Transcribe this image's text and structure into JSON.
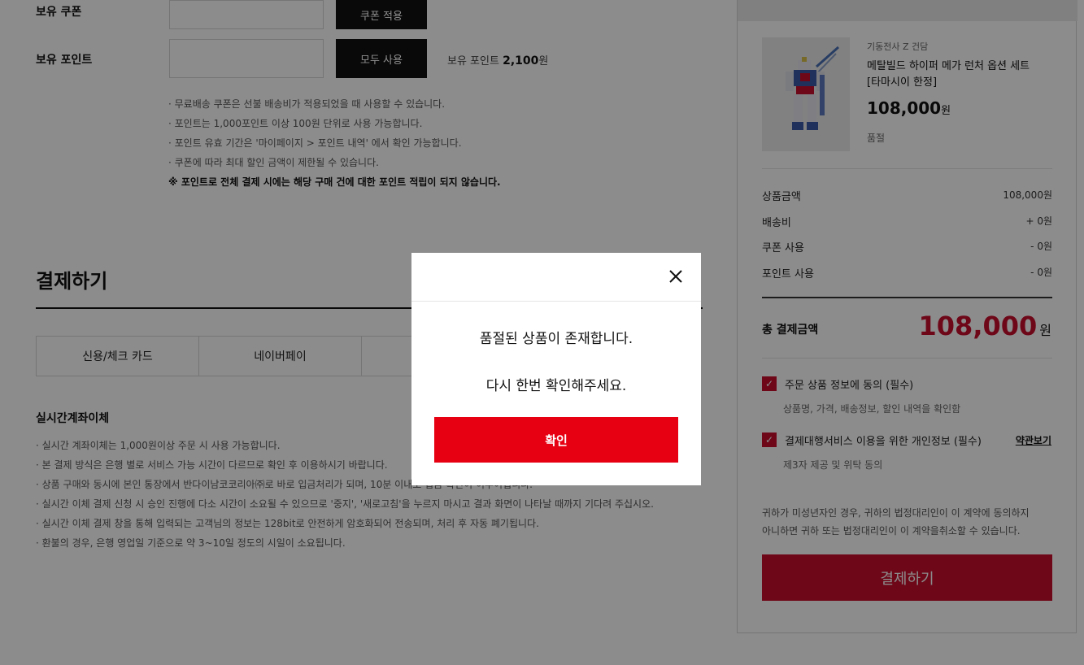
{
  "discount": {
    "coupon_label": "보유 쿠폰",
    "coupon_button": "쿠폰 적용",
    "point_label": "보유 포인트",
    "point_button": "모두 사용",
    "point_balance_prefix": "보유 포인트",
    "point_balance_value": "2,100",
    "point_balance_unit": "원",
    "notes": [
      "· 무료배송 쿠폰은 선불 배송비가 적용되었을 때 사용할 수 있습니다.",
      "· 포인트는 1,000포인트 이상 100원 단위로 사용 가능합니다.",
      "· 포인트 유효 기간은 '마이페이지 > 포인트 내역' 에서 확인 가능합니다.",
      "· 쿠폰에 따라 최대 할인 금액이 제한될 수 있습니다."
    ],
    "notice_strong": "※ 포인트로 전체 결제 시에는 해당 구매 건에 대한 포인트 적립이 되지 않습니다."
  },
  "payment": {
    "title": "결제하기",
    "tabs": [
      "신용/체크 카드",
      "네이버페이",
      ""
    ],
    "selected_method_title": "실시간계좌이체",
    "notes": [
      "· 실시간 계좌이체는 1,000원이상 주문 시 사용 가능합니다.",
      "· 본 결제 방식은 은행 별로 서비스 가능 시간이 다르므로 확인 후 이용하시기 바랍니다.",
      "· 상품 구매와 동시에 본인 통장에서 반다이남코코리아㈜로 바로 입금처리가 되며, 10분 이내로 입금 확인이 이루어집니다.",
      "· 실시간 이체 결제 신청 시 승인 진행에 다소 시간이 소요될 수 있으므로 '중지', '새로고침'을 누르지 마시고 결과 화면이 나타날 때까지 기다려 주십시오.",
      "· 실시간 이체 결제 창을 통해 입력되는 고객님의 정보는 128bit로 안전하게 암호화되어 전송되며, 처리 후 자동 폐기됩니다.",
      "· 환불의 경우, 은행 영업일 기준으로 약 3~10일 정도의 시일이 소요됩니다."
    ]
  },
  "summary": {
    "product": {
      "brand": "기동전사 Z 건담",
      "name": "메탈빌드 하이퍼 메가 런처 옵션 세트 [타마시이 한정]",
      "price": "108,000",
      "price_unit": "원",
      "status": "품절"
    },
    "rows": [
      {
        "label": "상품금액",
        "value": "108,000원"
      },
      {
        "label": "배송비",
        "value": "+ 0원"
      },
      {
        "label": "쿠폰 사용",
        "value": "- 0원"
      },
      {
        "label": "포인트 사용",
        "value": "- 0원"
      }
    ],
    "total_label": "총 결제금액",
    "total_value": "108,000",
    "total_unit": "원",
    "agree1": "주문 상품 정보에 동의 (필수)",
    "agree1_sub": "상품명, 가격, 배송정보, 할인 내역을 확인함",
    "agree2": "결제대행서비스 이용을 위한 개인정보 (필수)",
    "agree2_sub": "제3자 제공 및 위탁 동의",
    "terms_link": "약관보기",
    "minor_notice_1": "귀하가 미성년자인 경우, 귀하의 법정대리인이 이 계약에 동의하지",
    "minor_notice_2": "아니하면 귀하 또는 법정대리인이 이 계약을취소할 수 있습니다.",
    "checkout_button": "결제하기"
  },
  "modal": {
    "message_1": "품절된 상품이 존재합니다.",
    "message_2": "다시 한번 확인해주세요.",
    "confirm_button": "확인",
    "close_icon": "close-icon"
  },
  "colors": {
    "accent_red": "#c8102e",
    "confirm_red": "#e60012",
    "dark_button": "#111111"
  }
}
